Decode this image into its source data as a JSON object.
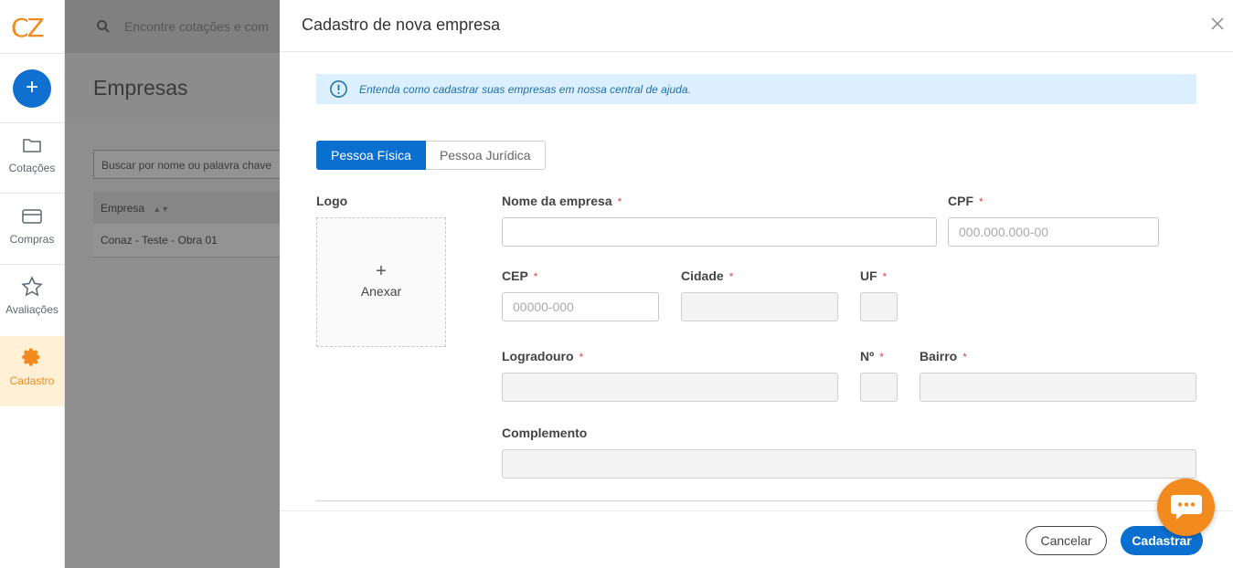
{
  "app": {
    "logo_text": "CZ",
    "brand_color": "#f28a1e",
    "primary_color": "#0b6fd0"
  },
  "sidebar": {
    "add_button_label": "+",
    "items": [
      {
        "label": "Cotações",
        "icon": "folder-icon",
        "active": false
      },
      {
        "label": "Compras",
        "icon": "credit-card-icon",
        "active": false
      },
      {
        "label": "Avaliações",
        "icon": "star-icon",
        "active": false
      },
      {
        "label": "Cadastro",
        "icon": "gear-icon",
        "active": true
      }
    ]
  },
  "background": {
    "search_placeholder": "Encontre cotações e com",
    "page_title": "Empresas",
    "filter_placeholder": "Buscar por nome ou palavra chave",
    "table": {
      "columns": [
        "Empresa"
      ],
      "rows": [
        [
          "Conaz - Teste - Obra 01"
        ]
      ]
    }
  },
  "modal": {
    "title": "Cadastro de nova empresa",
    "close_label": "X",
    "info_text": "Entenda como cadastrar suas empresas em nossa central de ajuda.",
    "tabs": [
      {
        "label": "Pessoa Física",
        "active": true
      },
      {
        "label": "Pessoa Jurídica",
        "active": false
      }
    ],
    "logo": {
      "label": "Logo",
      "plus": "+",
      "attach_label": "Anexar"
    },
    "fields": {
      "nome": {
        "label": "Nome da empresa",
        "required_mark": "*",
        "value": "",
        "placeholder": ""
      },
      "cpf": {
        "label": "CPF",
        "required_mark": "*",
        "value": "",
        "placeholder": "000.000.000-00"
      },
      "cep": {
        "label": "CEP",
        "required_mark": "*",
        "value": "",
        "placeholder": "00000-000"
      },
      "cidade": {
        "label": "Cidade",
        "required_mark": "*",
        "value": "",
        "placeholder": ""
      },
      "uf": {
        "label": "UF",
        "required_mark": "*",
        "value": "",
        "placeholder": ""
      },
      "logradouro": {
        "label": "Logradouro",
        "required_mark": "*",
        "value": "",
        "placeholder": ""
      },
      "numero": {
        "label": "Nº",
        "required_mark": "*",
        "value": "",
        "placeholder": ""
      },
      "bairro": {
        "label": "Bairro",
        "required_mark": "*",
        "value": "",
        "placeholder": ""
      },
      "complemento": {
        "label": "Complemento",
        "value": "",
        "placeholder": ""
      }
    },
    "buttons": {
      "cancel": "Cancelar",
      "submit": "Cadastrar"
    }
  }
}
